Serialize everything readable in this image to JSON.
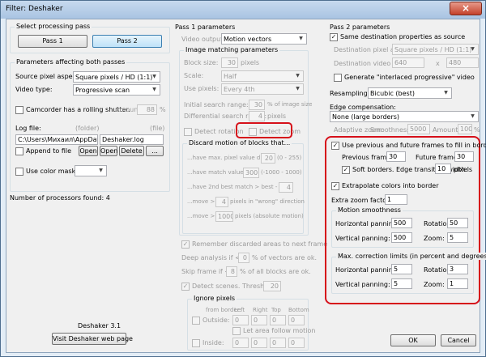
{
  "window": {
    "title": "Filter: Deshaker",
    "close_icon": "×"
  },
  "left": {
    "select_pass_group": "Select processing pass",
    "pass1": "Pass 1",
    "pass2": "Pass 2",
    "params_group": "Parameters affecting both passes",
    "source_pixel_label": "Source pixel aspect:",
    "source_pixel_value": "Square pixels / HD  (1:1)",
    "video_type_label": "Video type:",
    "video_type_value": "Progressive scan",
    "camcorder_label": "Camcorder has a rolling shutter.",
    "amount_label": "Amount:",
    "amount_value": "88",
    "percent": "%",
    "log_label": "Log file:",
    "folder": "(folder)",
    "file": "(file)",
    "log_path": "C:\\Users\\Михаил\\AppData\\Lo",
    "log_file": "Deshaker.log",
    "append_label": "Append to file",
    "open1": "Open",
    "open2": "Open",
    "delete": "Delete",
    "more": "...",
    "color_mask_label": "Use color mask:",
    "processors": "Number of processors found:  4",
    "version": "Deshaker 3.1",
    "web_button": "Visit Deshaker web page"
  },
  "mid": {
    "header": "Pass 1 parameters",
    "video_output_label": "Video output:",
    "video_output_value": "Motion vectors",
    "matching_group": "Image matching parameters",
    "block_size": "Block size:",
    "block_size_val": "30",
    "pixels": "pixels",
    "scale": "Scale:",
    "scale_val": "Half",
    "use_pixels": "Use pixels:",
    "use_pixels_val": "Every 4th",
    "init_search": "Initial search range:",
    "init_search_val": "30",
    "pct_image": "% of image size",
    "diff_search": "Differential search range:",
    "diff_search_val": "4",
    "detect_rotation": "Detect rotation",
    "detect_zoom": "Detect zoom",
    "discard_group": "Discard motion of blocks that...",
    "d1": "...have max. pixel value diff. <",
    "d1_val": "20",
    "d1_rng": "(0 - 255)",
    "d2": "...have match value <",
    "d2_val": "300",
    "d2_rng": "(-1000 - 1000)",
    "d3": "...have 2nd best match > best -",
    "d3_val": "4",
    "d4": "...move >",
    "d4_val": "4",
    "d4_t": "pixels in \"wrong\" direction",
    "d5": "...move >",
    "d5_val": "1000",
    "d5_t": "pixels (absolute motion)",
    "remember": "Remember discarded areas to next frame",
    "deep": "Deep analysis if <",
    "deep_val": "0",
    "deep_t": "% of vectors are ok.",
    "skip": "Skip frame if <",
    "skip_val": "8",
    "skip_t": "% of all blocks are ok.",
    "detect_scenes": "Detect scenes. Threshold:",
    "threshold_val": "20",
    "ignore_group": "Ignore pixels",
    "from_border": "from border:",
    "left": "Left",
    "right": "Right",
    "top": "Top",
    "bottom": "Bottom",
    "outside": "Outside:",
    "outside_l": "0",
    "outside_r": "0",
    "outside_t": "0",
    "outside_b": "0",
    "let_area": "Let area follow motion",
    "inside": "Inside:",
    "inside_l": "0",
    "inside_r": "0",
    "inside_t": "0",
    "inside_b": "0"
  },
  "right": {
    "header": "Pass 2 parameters",
    "same_dest": "Same destination properties as source",
    "dest_pixel": "Destination pixel aspect:",
    "dest_pixel_val": "Square pixels / HD  (1:1)",
    "dest_video": "Destination video size:",
    "dest_w": "640",
    "x": "x",
    "dest_h": "480",
    "interlaced": "Generate \"interlaced progressive\" video",
    "resampling": "Resampling:",
    "resampling_val": "Bicubic  (best)",
    "edge_comp": "Edge compensation:",
    "edge_comp_val": "None  (large borders)",
    "adaptive": "Adaptive zoom:",
    "smoothness": "Smoothness:",
    "smooth_val": "5000",
    "amount": "Amount:",
    "amount_val": "100",
    "pct": "%",
    "use_prev": "Use previous and future frames to fill in borders",
    "prev_frames": "Previous frames:",
    "prev_val": "30",
    "future_frames": "Future frames:",
    "future_val": "30",
    "soft_borders": "Soft borders. Edge transition width:",
    "soft_val": "10",
    "pixels": "pixels",
    "extrapolate": "Extrapolate colors into border",
    "extra_zoom": "Extra zoom factor:",
    "extra_zoom_val": "1",
    "motion_group": "Motion smoothness",
    "h_pan": "Horizontal panning:",
    "h_pan_val": "500",
    "rotation": "Rotation:",
    "rotation_val": "50",
    "v_pan": "Vertical panning:",
    "v_pan_val": "500",
    "zoom": "Zoom:",
    "zoom_val": "5",
    "max_group": "Max. correction limits (in percent and degrees)",
    "mh_pan": "Horizontal panning:",
    "mh_pan_val": "5",
    "mrotation": "Rotation:",
    "mrotation_val": "3",
    "mv_pan": "Vertical panning:",
    "mv_pan_val": "5",
    "mzoom": "Zoom:",
    "mzoom_val": "1",
    "ok": "OK",
    "cancel": "Cancel"
  },
  "colors": {
    "highlight": "#d6101a",
    "selected_button": "#bfe2f8"
  }
}
